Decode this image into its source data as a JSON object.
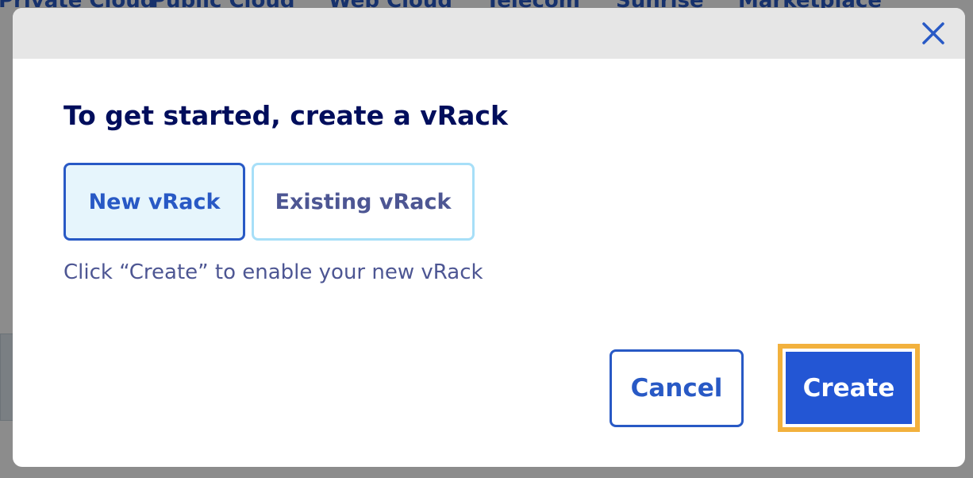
{
  "background": {
    "nav": [
      "Private Cloud",
      "Public Cloud",
      "Web Cloud",
      "Telecom",
      "Sunrise",
      "Marketplace"
    ]
  },
  "modal": {
    "close_icon": "close-icon",
    "title": "To get started, create a vRack",
    "options": [
      {
        "label": "New vRack",
        "selected": true
      },
      {
        "label": "Existing vRack",
        "selected": false
      }
    ],
    "hint": "Click “Create” to enable your new vRack",
    "cancel_label": "Cancel",
    "create_label": "Create"
  },
  "colors": {
    "primary": "#2859c5",
    "title": "#000e5c",
    "muted_text": "#4d5693",
    "focus_ring": "#f2b13d",
    "selected_bg": "#e6f5fc",
    "tile_border": "#a7dff8"
  }
}
